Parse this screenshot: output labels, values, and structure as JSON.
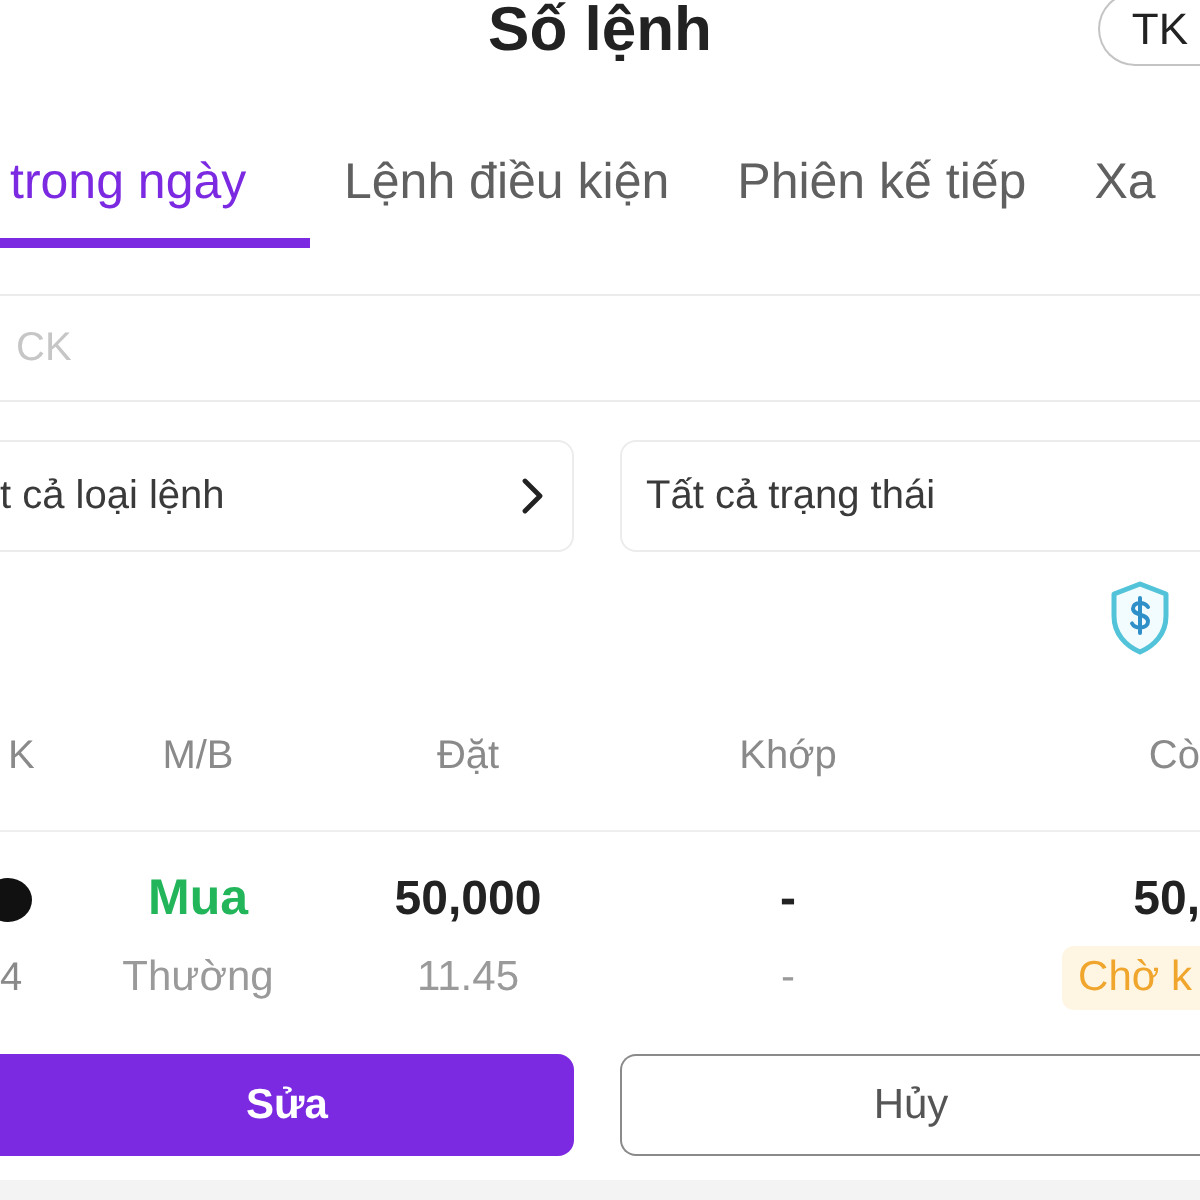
{
  "header": {
    "title": "Số lệnh",
    "account_button": "TK"
  },
  "tabs": [
    {
      "label": "trong ngày",
      "selected": true
    },
    {
      "label": "Lệnh điều kiện",
      "selected": false
    },
    {
      "label": "Phiên kế tiếp",
      "selected": false
    },
    {
      "label": "Xa",
      "selected": false
    }
  ],
  "search": {
    "placeholder": "CK"
  },
  "filters": [
    {
      "label": "t cả loại lệnh",
      "chevron": true
    },
    {
      "label": "Tất cả trạng thái",
      "chevron": false
    }
  ],
  "table": {
    "columns": [
      "K",
      "M/B",
      "Đặt",
      "Khớp",
      "Cò"
    ],
    "rows": [
      {
        "symbol": "4",
        "side": {
          "text": "Mua",
          "kind": "buy"
        },
        "order_type": "Thường",
        "quantity": "50,000",
        "price": "11.45",
        "matched_quantity": "-",
        "matched_price": "-",
        "remaining": "50,",
        "status": {
          "text": "Chờ k",
          "kind": "pending"
        }
      }
    ]
  },
  "actions": [
    {
      "label": "Sửa",
      "kind": "primary"
    },
    {
      "label": "Hủy",
      "kind": "outline"
    }
  ]
}
